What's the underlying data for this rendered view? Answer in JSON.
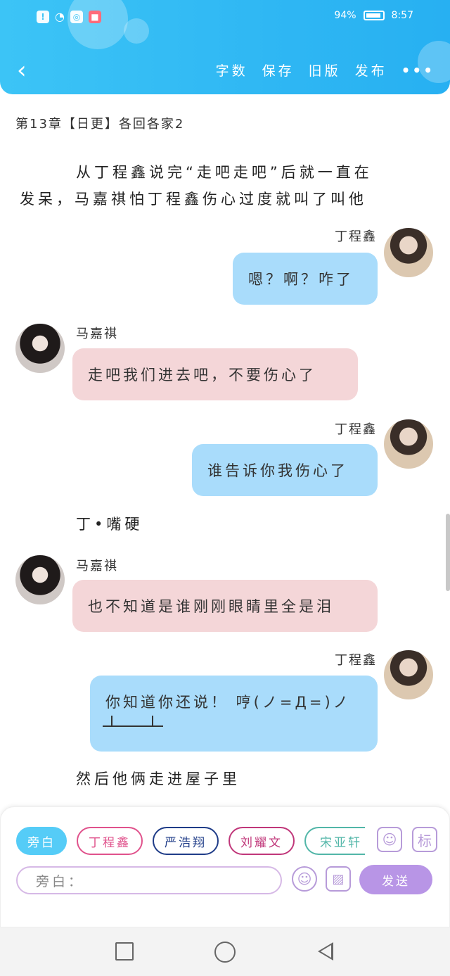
{
  "status": {
    "battery_percent": "94%",
    "time": "8:57"
  },
  "header": {
    "back_label": "‹",
    "actions": [
      "字数",
      "保存",
      "旧版",
      "发布"
    ],
    "more_label": "•••"
  },
  "chapter_title": "第13章【日更】各回各家2",
  "messages": {
    "narr1_line1": "从丁程鑫说完“走吧走吧”后就一直在",
    "narr1_line2": "发呆，马嘉祺怕丁程鑫伤心过度就叫了叫他",
    "m1_name": "丁程鑫",
    "m1_text": "嗯？啊？咋了",
    "m2_name": "马嘉祺",
    "m2_text": "走吧我们进去吧，不要伤心了",
    "m3_name": "丁程鑫",
    "m3_text": "谁告诉你我伤心了",
    "narr2": "丁•嘴硬",
    "m4_name": "马嘉祺",
    "m4_text": "也不知道是谁刚刚眼睛里全是泪",
    "m5_name": "丁程鑫",
    "m5_text": "你知道你还说！ 哼(ノ=Д=)ノ",
    "narr3": "然后他俩走进屋子里"
  },
  "bottom": {
    "chips": [
      "旁白",
      "丁程鑫",
      "严浩翔",
      "刘耀文",
      "宋亚轩"
    ],
    "chip_colors": [
      "#55ccf7",
      "#e0528c",
      "#1f3c88",
      "#c0377a",
      "#52b6a8"
    ],
    "input_placeholder": "旁白：",
    "send_label": "发送",
    "tag_label": "标"
  }
}
